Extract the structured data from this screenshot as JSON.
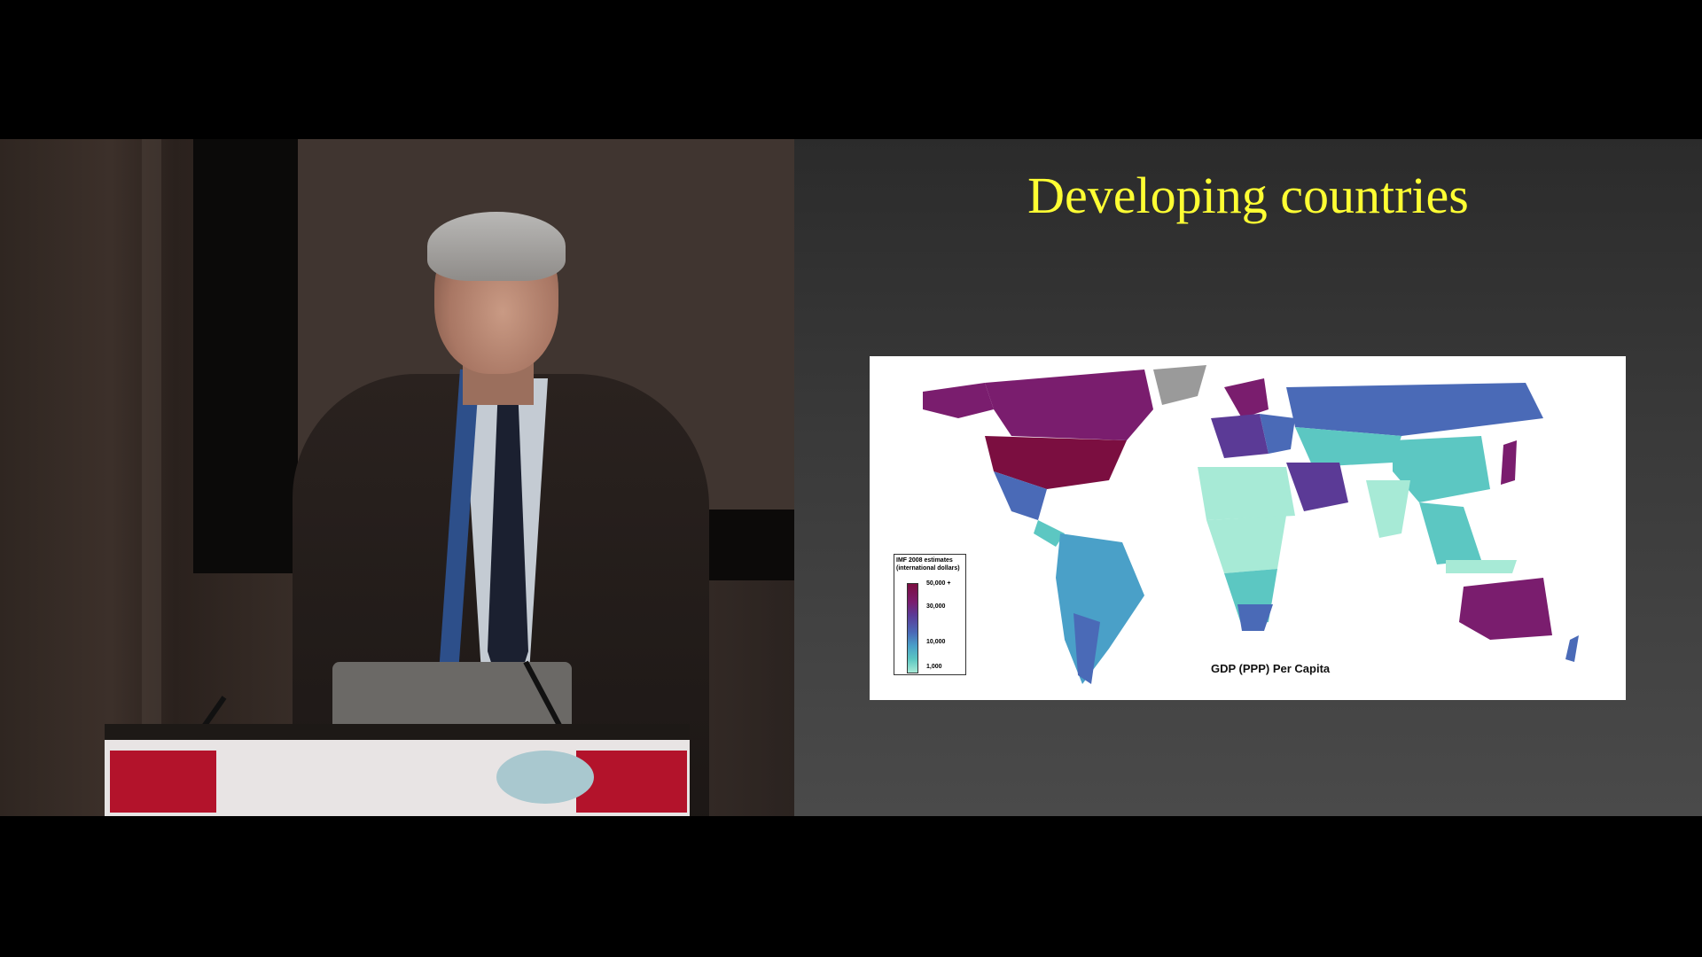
{
  "slide": {
    "title": "Developing countries"
  },
  "map": {
    "caption": "GDP (PPP) Per Capita",
    "legend": {
      "title_line1": "IMF 2008 estimates",
      "title_line2": "(international dollars)",
      "ticks": [
        "50,000 +",
        "30,000",
        "10,000",
        "1,000"
      ]
    }
  },
  "colors": {
    "title": "#ffff33",
    "high": "#7b0e40",
    "upper": "#7a1d6e",
    "mid": "#4a6ab7",
    "lower": "#5cc7c2",
    "low": "#a7ead6",
    "no_data": "#9a9a9a"
  }
}
